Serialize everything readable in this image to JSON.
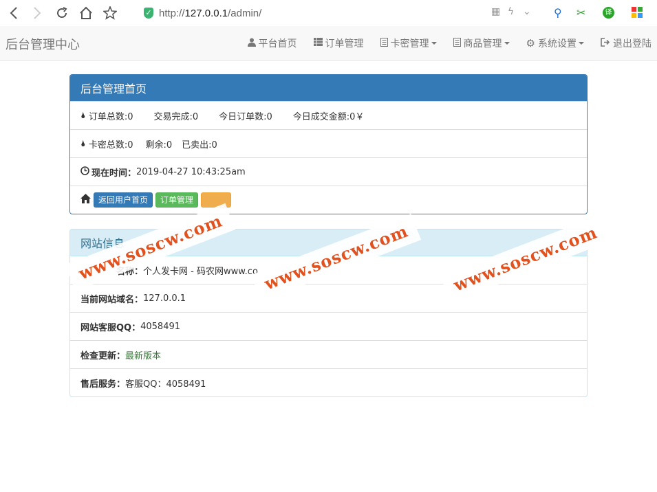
{
  "browser": {
    "url_prefix": "http://",
    "url_host": "127.0.0.1",
    "url_path": "/admin/"
  },
  "navbar": {
    "brand": "后台管理中心",
    "items": [
      {
        "label": "平台首页",
        "icon": "user-icon"
      },
      {
        "label": "订单管理",
        "icon": "list-icon"
      },
      {
        "label": "卡密管理",
        "icon": "file-icon"
      },
      {
        "label": "商品管理",
        "icon": "file-icon"
      },
      {
        "label": "系统设置",
        "icon": "gear-icon"
      },
      {
        "label": "退出登陆",
        "icon": "logout-icon"
      }
    ]
  },
  "dashboard": {
    "title": "后台管理首页",
    "order_total": "订单总数:0",
    "trade_done": "交易完成:0",
    "today_orders": "今日订单数:0",
    "today_amount": "今日成交金额:0￥",
    "card_total": "卡密总数:0",
    "card_left": "剩余:0",
    "card_sold": "已卖出:0",
    "time_label": "现在时间：",
    "time_value": "2019-04-27 10:43:25am",
    "btn_home": "返回用户首页",
    "btn_orders": "订单管理"
  },
  "siteinfo": {
    "title": "网站信息",
    "name_label": "名称：",
    "name_value": "个人发卡网 - 码农网www.co",
    "domain_label": "当前网站域名：",
    "domain_value": "127.0.0.1",
    "qq_label": "网站客服QQ：",
    "qq_value": "4058491",
    "update_label": "检查更新：",
    "update_value": "最新版本",
    "service_label": "售后服务：",
    "service_value": "客服QQ：4058491"
  },
  "watermark": "www.soscw.com",
  "colors": {
    "primary": "#337ab7",
    "info_bg": "#d9edf7",
    "success": "#5cb85c",
    "watermark": "#e2521f"
  }
}
